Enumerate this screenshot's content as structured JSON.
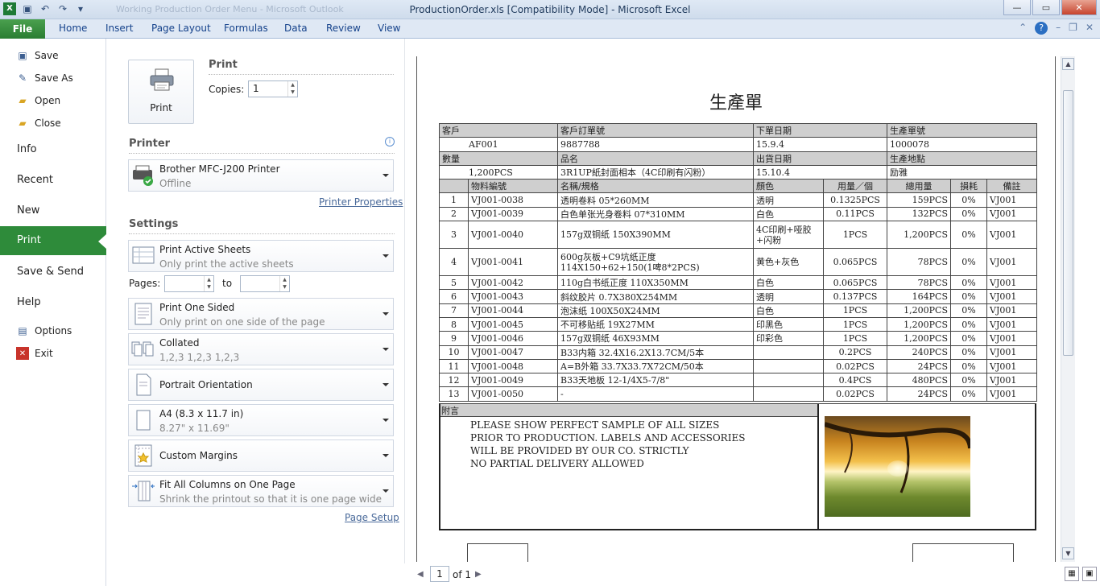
{
  "window": {
    "title": "ProductionOrder.xls  [Compatibility Mode]  -  Microsoft Excel",
    "faded_title": "Working Production Order Menu - Microsoft Outlook",
    "minimize": "—",
    "restore": "▭",
    "close": "✕"
  },
  "ribbon": {
    "file_tab": "File",
    "tabs": [
      "Home",
      "Insert",
      "Page Layout",
      "Formulas",
      "Data",
      "Review",
      "View"
    ]
  },
  "nav": {
    "save": "Save",
    "save_as": "Save As",
    "open": "Open",
    "close": "Close",
    "info": "Info",
    "recent": "Recent",
    "new": "New",
    "print": "Print",
    "save_send": "Save & Send",
    "help": "Help",
    "options": "Options",
    "exit": "Exit"
  },
  "print": {
    "button_label": "Print",
    "section_title": "Print",
    "copies_label": "Copies:",
    "copies_value": "1",
    "printer_title": "Printer",
    "printer_name": "Brother MFC-J200 Printer",
    "printer_status": "Offline",
    "printer_properties": "Printer Properties",
    "settings_title": "Settings",
    "sheets_main": "Print Active Sheets",
    "sheets_sub": "Only print the active sheets",
    "pages_label": "Pages:",
    "to_label": "to",
    "sided_main": "Print One Sided",
    "sided_sub": "Only print on one side of the page",
    "collated_main": "Collated",
    "collated_sub": "1,2,3    1,2,3    1,2,3",
    "orientation_main": "Portrait Orientation",
    "paper_main": "A4 (8.3 x 11.7 in)",
    "paper_sub": "8.27\" x 11.69\"",
    "margins_main": "Custom Margins",
    "scaling_main": "Fit All Columns on One Page",
    "scaling_sub": "Shrink the printout so that it is one page wide",
    "page_setup": "Page Setup"
  },
  "preview": {
    "doc_title": "生產單",
    "header1": [
      "客戶",
      "客戶訂單號",
      "下單日期",
      "生產單號"
    ],
    "values1": [
      "AF001",
      "9887788",
      "15.9.4",
      "1000078"
    ],
    "header2": [
      "數量",
      "品名",
      "出貨日期",
      "生產地點"
    ],
    "values2": [
      "1,200PCS",
      "3R1UP紙封面相本（4C印刷有闪粉）",
      "15.10.4",
      "励雅"
    ],
    "columns": [
      "",
      "物料編號",
      "名稱/規格",
      "顏色",
      "用量／個",
      "總用量",
      "損耗",
      "備註"
    ],
    "rows": [
      [
        "1",
        "VJ001-0038",
        "透明卷料 05*260MM",
        "透明",
        "0.1325PCS",
        "159PCS",
        "0%",
        "VJ001"
      ],
      [
        "2",
        "VJ001-0039",
        "白色单张光身卷料 07*310MM",
        "白色",
        "0.11PCS",
        "132PCS",
        "0%",
        "VJ001"
      ],
      [
        "3",
        "VJ001-0040",
        "157g双铜纸 150X390MM",
        "4C印刷+哑胶+闪粉",
        "1PCS",
        "1,200PCS",
        "0%",
        "VJ001"
      ],
      [
        "4",
        "VJ001-0041",
        "600g灰板+C9坑纸正度 114X150+62+150(1啤8*2PCS)",
        "黄色+灰色",
        "0.065PCS",
        "78PCS",
        "0%",
        "VJ001"
      ],
      [
        "5",
        "VJ001-0042",
        "110g白书纸正度 110X350MM",
        "白色",
        "0.065PCS",
        "78PCS",
        "0%",
        "VJ001"
      ],
      [
        "6",
        "VJ001-0043",
        "斜纹胶片 0.7X380X254MM",
        "透明",
        "0.137PCS",
        "164PCS",
        "0%",
        "VJ001"
      ],
      [
        "7",
        "VJ001-0044",
        "泡沫纸 100X50X24MM",
        "白色",
        "1PCS",
        "1,200PCS",
        "0%",
        "VJ001"
      ],
      [
        "8",
        "VJ001-0045",
        "不可移贴纸 19X27MM",
        "印黑色",
        "1PCS",
        "1,200PCS",
        "0%",
        "VJ001"
      ],
      [
        "9",
        "VJ001-0046",
        "157g双铜纸 46X93MM",
        "印彩色",
        "1PCS",
        "1,200PCS",
        "0%",
        "VJ001"
      ],
      [
        "10",
        "VJ001-0047",
        "B33内箱 32.4X16.2X13.7CM/5本",
        "",
        "0.2PCS",
        "240PCS",
        "0%",
        "VJ001"
      ],
      [
        "11",
        "VJ001-0048",
        "A=B外箱 33.7X33.7X72CM/50本",
        "",
        "0.02PCS",
        "24PCS",
        "0%",
        "VJ001"
      ],
      [
        "12",
        "VJ001-0049",
        "B33天地板 12-1/4X5-7/8\"",
        "",
        "0.4PCS",
        "480PCS",
        "0%",
        "VJ001"
      ],
      [
        "13",
        "VJ001-0050",
        "-",
        "",
        "0.02PCS",
        "24PCS",
        "0%",
        "VJ001"
      ]
    ],
    "notes_label": "附言",
    "notes_lines": [
      "PLEASE SHOW PERFECT SAMPLE OF ALL SIZES",
      "PRIOR TO PRODUCTION. LABELS AND ACCESSORIES",
      "WILL BE PROVIDED BY OUR CO. STRICTLY",
      "NO PARTIAL DELIVERY ALLOWED"
    ],
    "page_number": "1",
    "page_of": "of 1"
  }
}
